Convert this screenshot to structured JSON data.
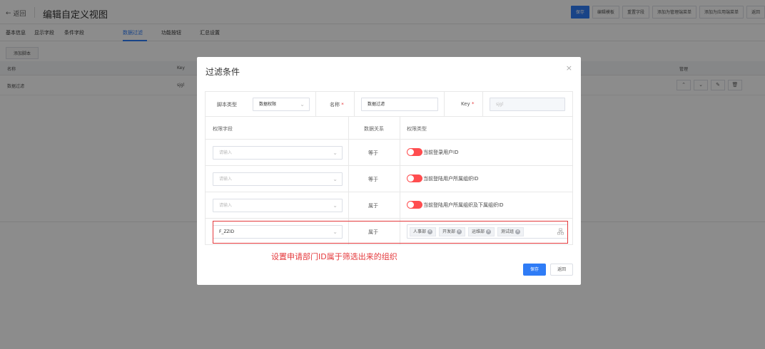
{
  "header": {
    "back_label": "返回",
    "title": "编辑自定义视图",
    "actions": [
      "保存",
      "编辑模板",
      "重置字段",
      "添加为管理端菜单",
      "添加为应用端菜单",
      "返回"
    ]
  },
  "tabs": [
    "基本信息",
    "显示字段",
    "条件字段",
    "数据过滤",
    "功能按钮",
    "汇总设置"
  ],
  "active_tab": "数据过滤",
  "list": {
    "add_button": "添加脚本",
    "columns": [
      "名称",
      "Key",
      "管理"
    ],
    "rows": [
      {
        "name": "数据过滤",
        "key": "sjgl"
      }
    ]
  },
  "modal": {
    "title": "过滤条件",
    "close": "×",
    "script_type_label": "脚本类型",
    "script_type_value": "数据权限",
    "name_label": "名称",
    "name_value": "数据过滤",
    "key_label": "Key",
    "key_value": "sjgl",
    "required_mark": "*",
    "table_headers": [
      "权限字段",
      "数据关系",
      "权限类型"
    ],
    "placeholder": "请输入",
    "rows": [
      {
        "relation": "等于",
        "type_label": "当前登录用户ID"
      },
      {
        "relation": "等于",
        "type_label": "当前登陆用户所属组织ID"
      },
      {
        "relation": "属于",
        "type_label": "当前登陆用户所属组织及下属组织ID"
      }
    ],
    "custom_row": {
      "field": "F_ZZID",
      "relation": "属于",
      "tags": [
        "人事部",
        "开发部",
        "运维部",
        "测试组"
      ]
    },
    "annotation": "设置申请部门ID属于筛选出来的组织",
    "save_label": "保存",
    "back_label": "返回"
  },
  "colors": {
    "primary": "#2f7cf6",
    "danger": "#e4393c",
    "toggle": "#ff4d4f"
  }
}
